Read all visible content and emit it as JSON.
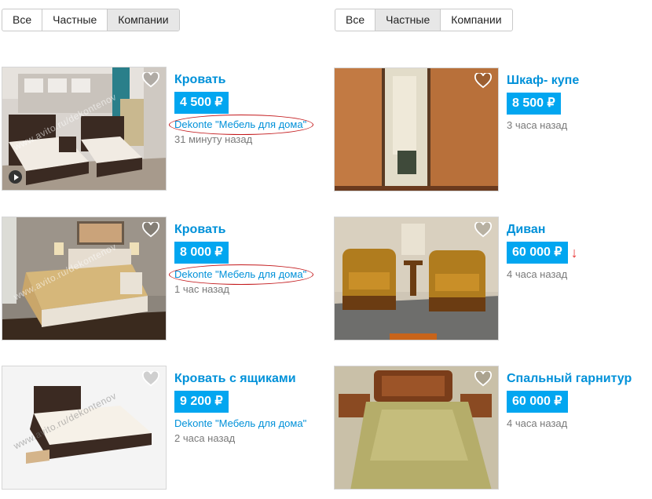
{
  "filters_left": {
    "all": "Все",
    "private": "Частные",
    "companies": "Компании"
  },
  "filters_right": {
    "all": "Все",
    "private": "Частные",
    "companies": "Компании"
  },
  "watermark": "www.avito.ru/dekontenov",
  "listings": [
    {
      "title": "Кровать",
      "price": "4 500 ₽",
      "seller": "Dekonte \"Мебель для дома\"",
      "date": "31 минуту назад"
    },
    {
      "title": "Шкаф- купе",
      "price": "8 500 ₽",
      "date": "3 часа назад"
    },
    {
      "title": "Кровать",
      "price": "8 000 ₽",
      "seller": "Dekonte \"Мебель для дома\"",
      "date": "1 час назад"
    },
    {
      "title": "Диван",
      "price": "60 000 ₽",
      "price_drop": "↓",
      "date": "4 часа назад"
    },
    {
      "title": "Кровать с ящиками",
      "price": "9 200 ₽",
      "seller": "Dekonte \"Мебель для дома\"",
      "date": "2 часа назад"
    },
    {
      "title": "Спальный гарнитур",
      "price": "60 000 ₽",
      "date": "4 часа назад"
    }
  ],
  "colors": {
    "link": "#0091d9",
    "price_bg": "#02a6f0",
    "highlight": "#c3181b",
    "price_drop": "#e8312f"
  }
}
